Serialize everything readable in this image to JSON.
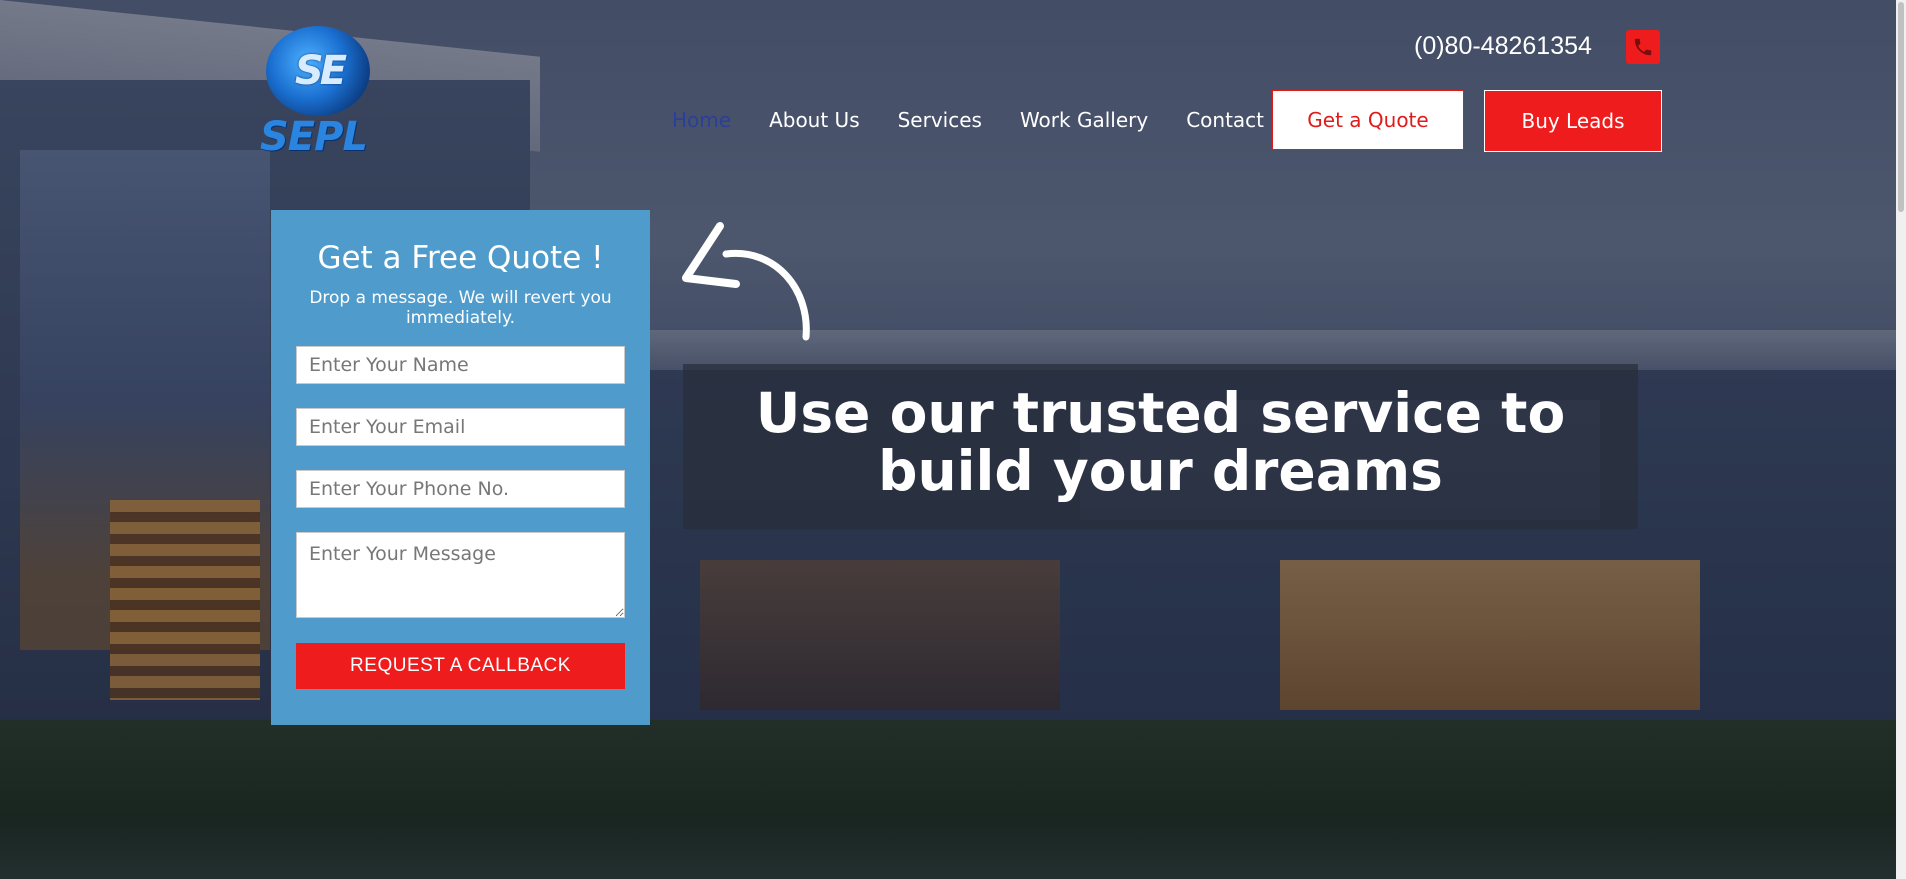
{
  "header": {
    "logo_text": "SEPL",
    "logo_mark": "SE",
    "phone": "(0)80-48261354",
    "phone_icon": "phone-icon",
    "nav": [
      {
        "label": "Home",
        "active": true
      },
      {
        "label": "About Us"
      },
      {
        "label": "Services"
      },
      {
        "label": "Work Gallery"
      },
      {
        "label": "Contact"
      }
    ],
    "quote_button": "Get a Quote",
    "leads_button": "Buy Leads"
  },
  "form": {
    "title": "Get a Free Quote !",
    "subtitle": "Drop a message. We will revert you immediately.",
    "name_placeholder": "Enter Your Name",
    "email_placeholder": "Enter Your Email",
    "phone_placeholder": "Enter Your Phone No.",
    "message_placeholder": "Enter Your Message",
    "submit_label": "REQUEST A CALLBACK"
  },
  "hero": {
    "headline": "Use our trusted service to build your dreams"
  },
  "colors": {
    "accent_red": "#ee1c1c",
    "form_blue": "#4f9bcb",
    "nav_active": "#2b3f98"
  }
}
